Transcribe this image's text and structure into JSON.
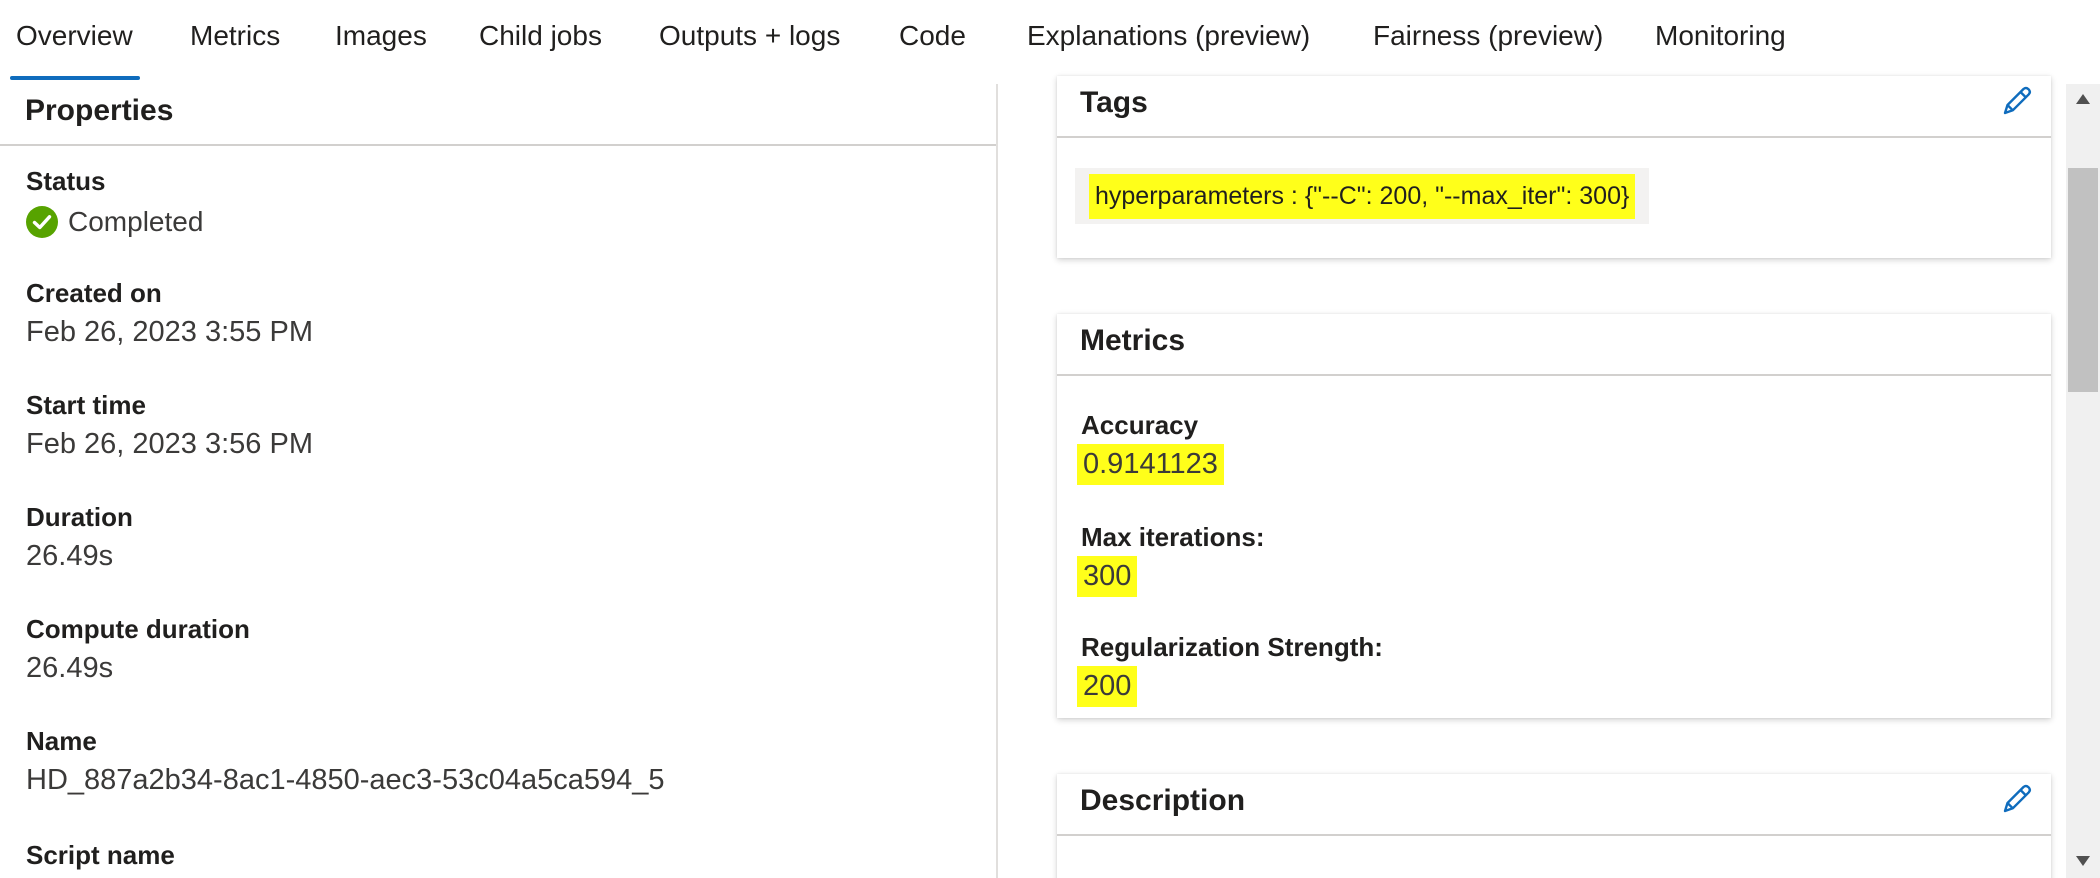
{
  "tabs": [
    {
      "label": "Overview",
      "active": true
    },
    {
      "label": "Metrics"
    },
    {
      "label": "Images"
    },
    {
      "label": "Child jobs"
    },
    {
      "label": "Outputs + logs"
    },
    {
      "label": "Code"
    },
    {
      "label": "Explanations (preview)"
    },
    {
      "label": "Fairness (preview)"
    },
    {
      "label": "Monitoring"
    }
  ],
  "properties": {
    "title": "Properties",
    "status_label": "Status",
    "status_value": "Completed",
    "created_label": "Created on",
    "created_value": "Feb 26, 2023 3:55 PM",
    "start_label": "Start time",
    "start_value": "Feb 26, 2023 3:56 PM",
    "duration_label": "Duration",
    "duration_value": "26.49s",
    "compute_label": "Compute duration",
    "compute_value": "26.49s",
    "name_label": "Name",
    "name_value": "HD_887a2b34-8ac1-4850-aec3-53c04a5ca594_5",
    "script_label": "Script name"
  },
  "tags": {
    "title": "Tags",
    "items": [
      "hyperparameters : {\"--C\": 200, \"--max_iter\": 300}"
    ]
  },
  "metrics": {
    "title": "Metrics",
    "items": [
      {
        "label": "Accuracy",
        "value": "0.9141123"
      },
      {
        "label": "Max iterations:",
        "value": "300"
      },
      {
        "label": "Regularization Strength:",
        "value": "200"
      }
    ]
  },
  "description": {
    "title": "Description"
  },
  "colors": {
    "accent": "#0f6cbd",
    "success": "#57a300",
    "highlight": "#ffff1a"
  }
}
